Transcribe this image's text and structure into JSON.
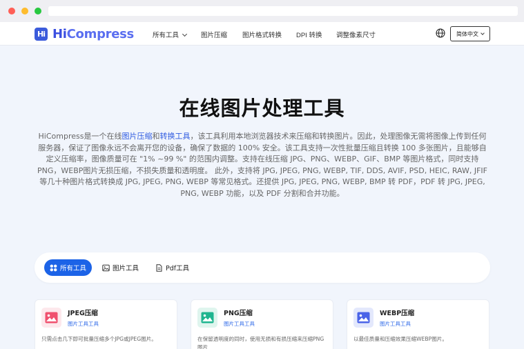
{
  "header": {
    "logo_mark": "Hi",
    "logo_hi": "Hi",
    "logo_rest": "Compress",
    "nav": [
      "所有工具",
      "图片压缩",
      "图片格式转换",
      "DPI 转换",
      "调整像素尺寸"
    ],
    "language": "简体中文"
  },
  "hero": {
    "title": "在线图片处理工具",
    "intro_pre": "HiCompress是一个在线",
    "link_compress": "图片压缩",
    "intro_and": "和",
    "link_convert": "转换工具",
    "intro_post": "，该工具利用本地浏览器技术来压缩和转换图片。因此，处理图像无需将图像上传到任何服务器，保证了图像永远不会离开您的设备，确保了数据的 100% 安全。该工具支持一次性批量压缩且转换 100 多张图片，且能够自定义压缩率，图像质量可在 \"1% ~99 %\" 的范围内调整。支持在线压缩 JPG、PNG、WEBP、GIF、BMP 等图片格式，同时支持PNG，WEBP图片无损压缩，不损失质量和透明度。 此外，支持将 JPG, JPEG, PNG, WEBP, TIF, DDS, AVIF, PSD, HEIC, RAW, JFIF 等几十种图片格式转换成 JPG, JPEG, PNG, WEBP 等常见格式。还提供 JPG, JPEG, PNG, WEBP, BMP 转 PDF，PDF 转 JPG, JPEG, PNG, WEBP 功能，以及 PDF 分割和合并功能。"
  },
  "tabs": {
    "all": "所有工具",
    "image": "图片工具",
    "pdf": "Pdf工具"
  },
  "cards": [
    {
      "title": "JPEG压缩",
      "tag": "图片工具工具",
      "desc": "只需点击几下即可批量压缩多个JPG或JPEG图片。",
      "color": "#f0506e",
      "bg": "#fde8ec"
    },
    {
      "title": "PNG压缩",
      "tag": "图片工具工具",
      "desc": "在保留透明度的同时，使用无损和有损压缩来压缩PNG图片",
      "color": "#1fb58f",
      "bg": "#dff5ee"
    },
    {
      "title": "WEBP压缩",
      "tag": "图片工具工具",
      "desc": "以最佳质量和压缩效果压缩WEBP图片。",
      "color": "#4a63e8",
      "bg": "#e3e8fc"
    }
  ]
}
